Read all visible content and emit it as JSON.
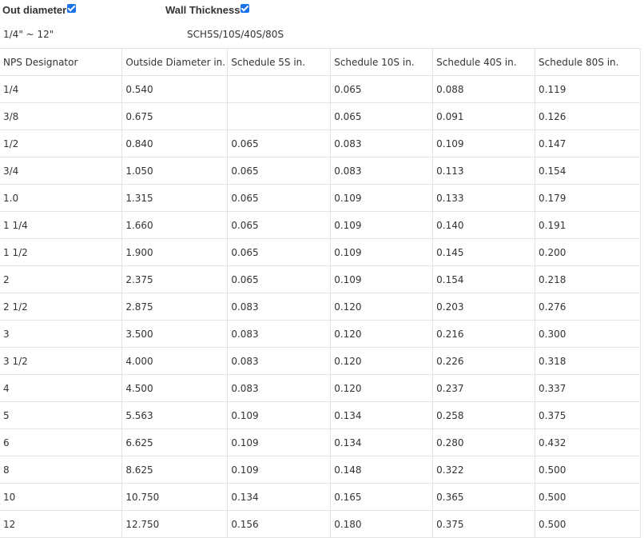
{
  "filters": {
    "out_diameter": {
      "label": "Out diameter",
      "checked": true,
      "range": "1/4\" ~ 12\""
    },
    "wall_thickness": {
      "label": "Wall Thickness",
      "checked": true,
      "range": "SCH5S/10S/40S/80S"
    }
  },
  "table": {
    "headers": [
      "NPS Designator",
      "Outside Diameter in.",
      "Schedule 5S in.",
      "Schedule 10S in.",
      "Schedule 40S in.",
      "Schedule 80S in."
    ],
    "rows": [
      [
        "1/4",
        "0.540",
        "",
        "0.065",
        "0.088",
        "0.119"
      ],
      [
        "3/8",
        "0.675",
        "",
        "0.065",
        "0.091",
        "0.126"
      ],
      [
        "1/2",
        "0.840",
        "0.065",
        "0.083",
        "0.109",
        "0.147"
      ],
      [
        "3/4",
        "1.050",
        "0.065",
        "0.083",
        "0.113",
        "0.154"
      ],
      [
        "1.0",
        "1.315",
        "0.065",
        "0.109",
        "0.133",
        "0.179"
      ],
      [
        "1 1/4",
        "1.660",
        "0.065",
        "0.109",
        "0.140",
        "0.191"
      ],
      [
        "1 1/2",
        "1.900",
        "0.065",
        "0.109",
        "0.145",
        "0.200"
      ],
      [
        "2",
        "2.375",
        "0.065",
        "0.109",
        "0.154",
        "0.218"
      ],
      [
        "2 1/2",
        "2.875",
        "0.083",
        "0.120",
        "0.203",
        "0.276"
      ],
      [
        "3",
        "3.500",
        "0.083",
        "0.120",
        "0.216",
        "0.300"
      ],
      [
        "3 1/2",
        "4.000",
        "0.083",
        "0.120",
        "0.226",
        "0.318"
      ],
      [
        "4",
        "4.500",
        "0.083",
        "0.120",
        "0.237",
        "0.337"
      ],
      [
        "5",
        "5.563",
        "0.109",
        "0.134",
        "0.258",
        "0.375"
      ],
      [
        "6",
        "6.625",
        "0.109",
        "0.134",
        "0.280",
        "0.432"
      ],
      [
        "8",
        "8.625",
        "0.109",
        "0.148",
        "0.322",
        "0.500"
      ],
      [
        "10",
        "10.750",
        "0.134",
        "0.165",
        "0.365",
        "0.500"
      ],
      [
        "12",
        "12.750",
        "0.156",
        "0.180",
        "0.375",
        "0.500"
      ]
    ]
  },
  "colors": {
    "checkbox": "#1a73e8",
    "text": "#333333",
    "border": "#e3e3e3"
  }
}
